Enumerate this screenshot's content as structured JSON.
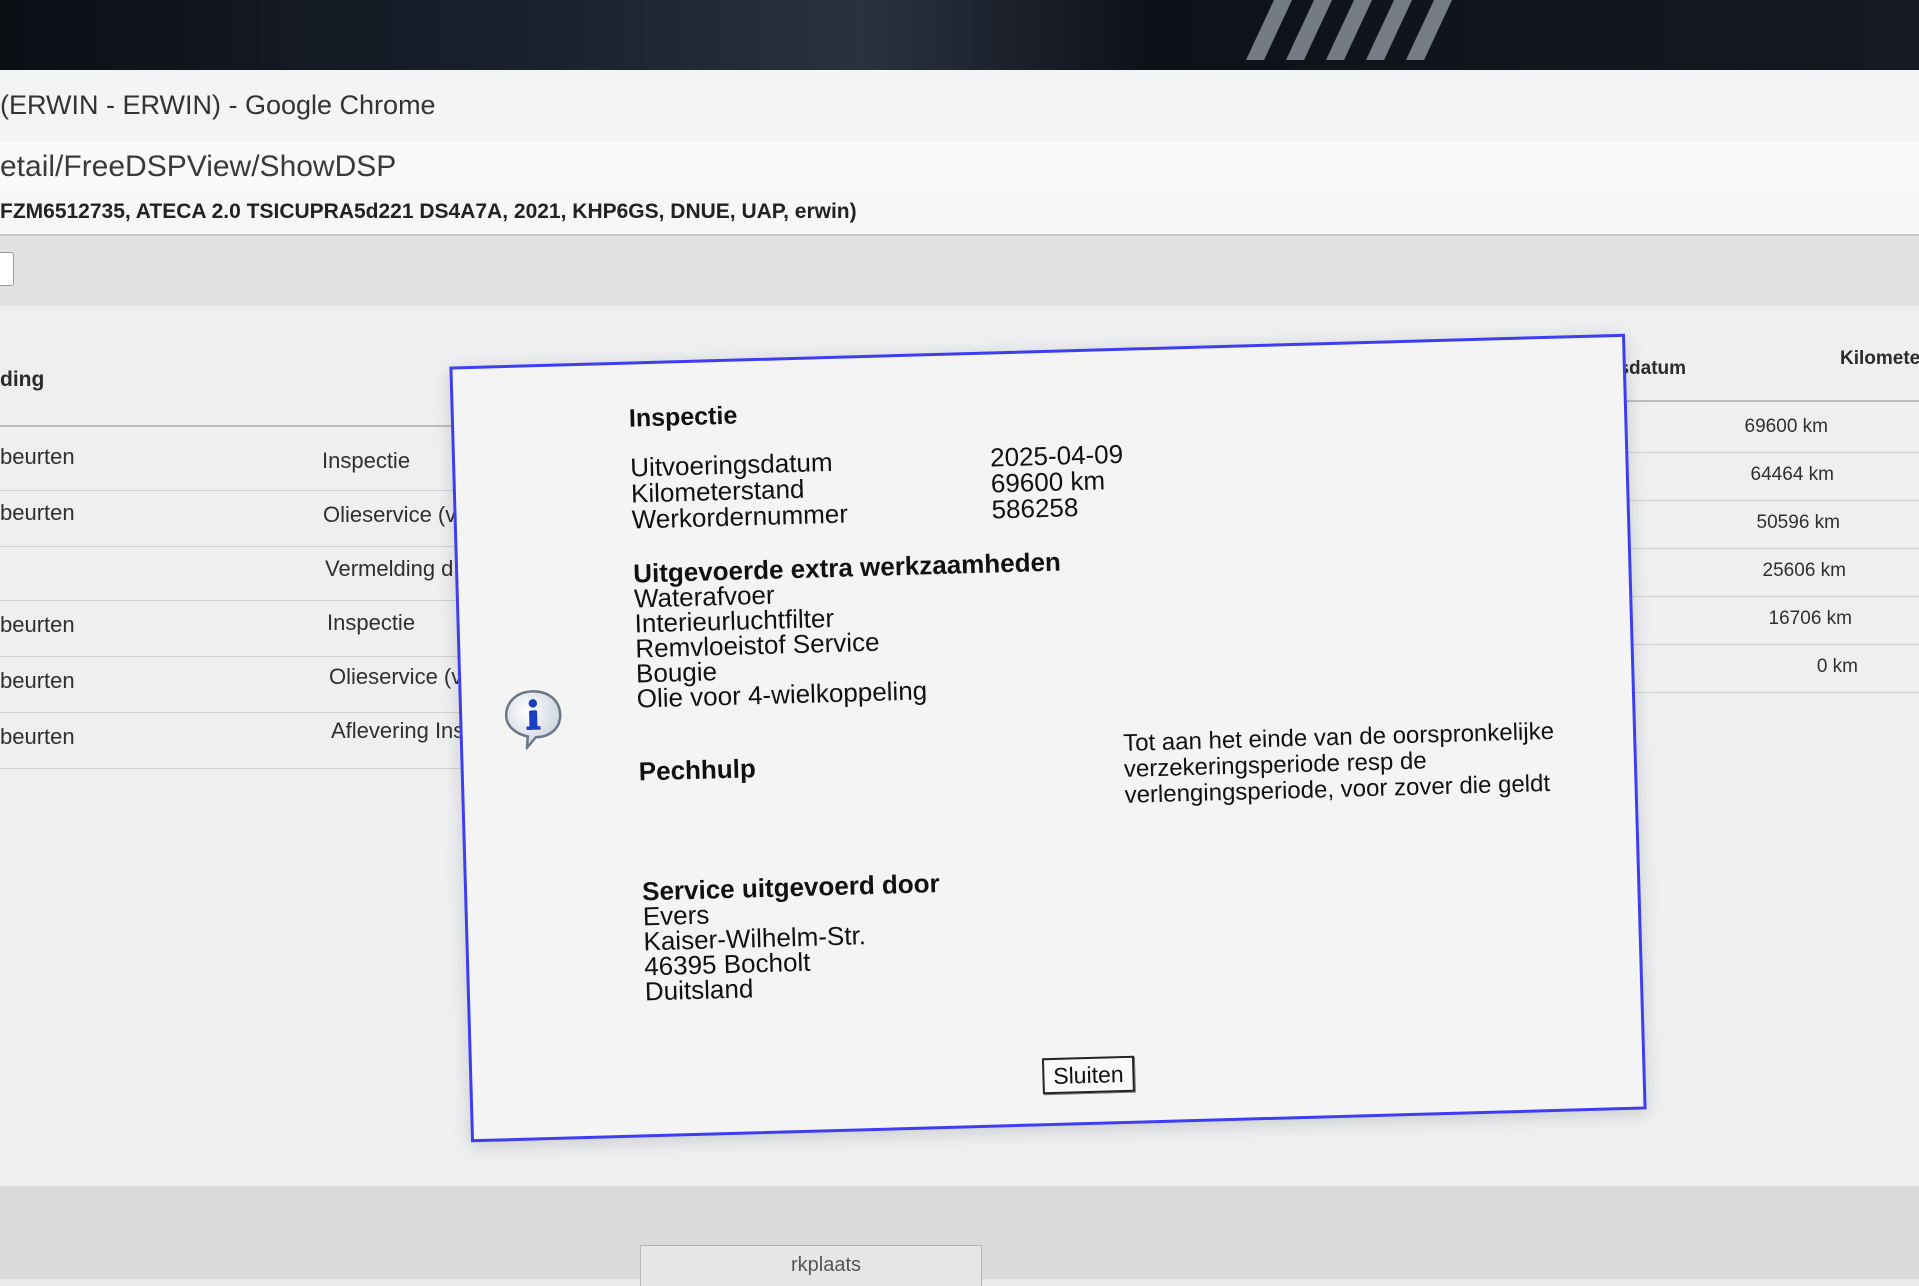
{
  "window": {
    "title": "(ERWIN - ERWIN) - Google Chrome",
    "url": "etail/FreeDSPView/ShowDSP",
    "vehicle_info": "FZM6512735, ATECA 2.0 TSICUPRA5d221 DS4A7A, 2021, KHP6GS, DNUE, UAP, erwin)"
  },
  "table": {
    "headers": {
      "col1": "ding",
      "col_date": "eringsdatum",
      "col_km": "Kilomete"
    },
    "rows": [
      {
        "type": "beurten",
        "service": "Inspectie",
        "km": "69600 km"
      },
      {
        "type": "beurten",
        "service": "Olieservice (v",
        "km": "64464 km"
      },
      {
        "type": "",
        "service": "Vermelding d",
        "km": "50596 km"
      },
      {
        "type": "beurten",
        "service": "Inspectie",
        "km": "25606 km"
      },
      {
        "type": "beurten",
        "service": "Olieservice (v",
        "km": "16706 km"
      },
      {
        "type": "beurten",
        "service": "Aflevering Ins",
        "km": "0 km"
      }
    ]
  },
  "dialog": {
    "title": "Inspectie",
    "fields": [
      {
        "label": "Uitvoeringsdatum",
        "value": "2025-04-09"
      },
      {
        "label": "Kilometerstand",
        "value": "69600 km"
      },
      {
        "label": "Werkordernummer",
        "value": "586258"
      }
    ],
    "extra_title": "Uitgevoerde extra werkzaamheden",
    "extra_items": [
      "Waterafvoer",
      "Interieurluchtfilter",
      "Remvloeistof Service",
      "Bougie",
      "Olie voor 4-wielkoppeling"
    ],
    "pechhulp_label": "Pechhulp",
    "pechhulp_text": "Tot aan het einde van de oorspronkelijke verzekeringsperiode resp de verlengingsperiode, voor zover die geldt",
    "service_title": "Service uitgevoerd door",
    "service_lines": [
      "Evers",
      "Kaiser-Wilhelm-Str.",
      "46395 Bocholt",
      "Duitsland"
    ],
    "close_label": "Sluiten",
    "icon": "info-icon"
  },
  "bottom": {
    "tab_label": "rkplaats"
  },
  "colors": {
    "dialog_border": "#3d3df2",
    "info_icon": "#1a3fbf"
  }
}
